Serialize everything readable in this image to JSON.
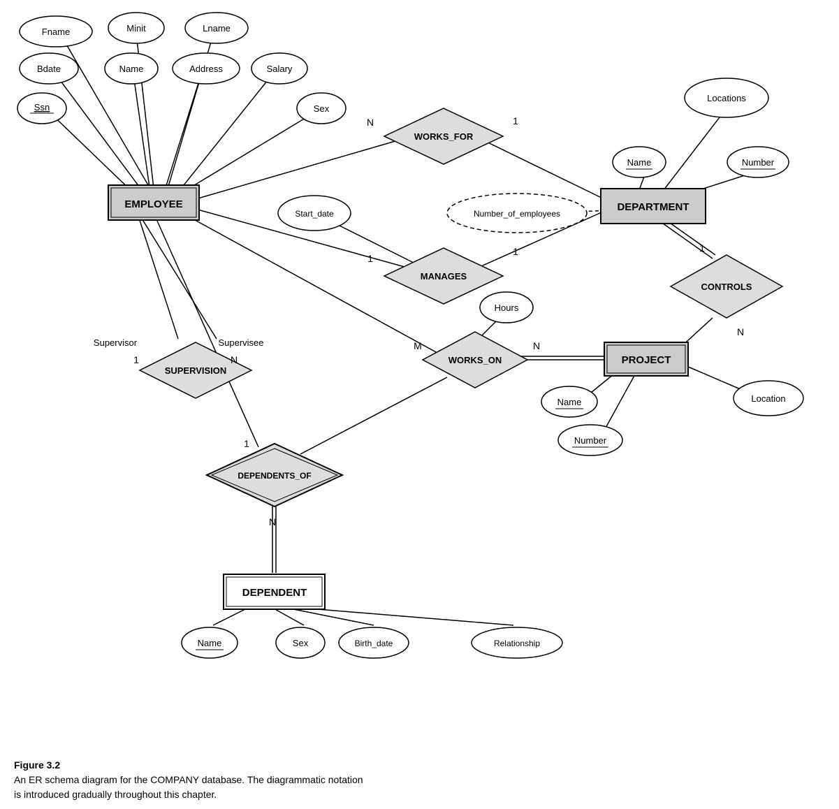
{
  "caption": {
    "title": "Figure 3.2",
    "line1": "An ER schema diagram for the COMPANY database. The diagrammatic notation",
    "line2": "is introduced gradually throughout this chapter."
  },
  "entities": {
    "employee": "EMPLOYEE",
    "department": "DEPARTMENT",
    "project": "PROJECT",
    "dependent": "DEPENDENT"
  },
  "relationships": {
    "works_for": "WORKS_FOR",
    "manages": "MANAGES",
    "works_on": "WORKS_ON",
    "supervision": "SUPERVISION",
    "dependents_of": "DEPENDENTS_OF",
    "controls": "CONTROLS"
  },
  "attributes": {
    "fname": "Fname",
    "minit": "Minit",
    "lname": "Lname",
    "bdate": "Bdate",
    "name_emp": "Name",
    "address": "Address",
    "salary": "Salary",
    "ssn": "Ssn",
    "sex_emp": "Sex",
    "start_date": "Start_date",
    "number_of_employees": "Number_of_employees",
    "locations": "Locations",
    "dept_name": "Name",
    "dept_number": "Number",
    "hours": "Hours",
    "proj_name": "Name",
    "proj_number": "Number",
    "proj_location": "Location",
    "dep_name": "Name",
    "dep_sex": "Sex",
    "dep_birth_date": "Birth_date",
    "relationship": "Relationship"
  },
  "cardinalities": {
    "works_for_n": "N",
    "works_for_1": "1",
    "manages_1_left": "1",
    "manages_1_right": "1",
    "works_on_m": "M",
    "works_on_n": "N",
    "supervision_1": "1",
    "supervision_n": "N",
    "dependents_of_1": "1",
    "dependents_of_n": "N",
    "controls_1": "1",
    "controls_n": "N"
  }
}
